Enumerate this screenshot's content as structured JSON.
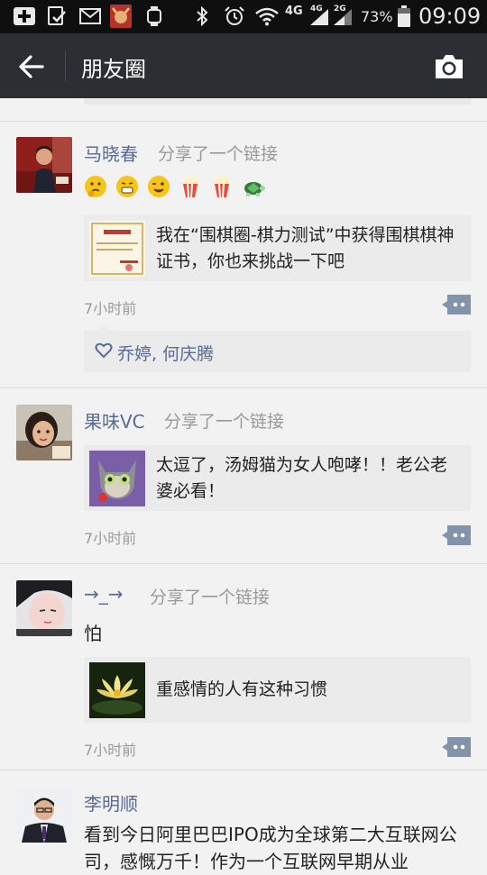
{
  "status_bar": {
    "network_4g": "4G",
    "network_4g_small": "4G",
    "network_2g": "2G",
    "battery": "73%",
    "time": "09:09"
  },
  "nav": {
    "title": "朋友圈",
    "back_icon": "back-arrow-icon",
    "camera_icon": "camera-icon"
  },
  "posts": [
    {
      "name": "马晓春",
      "action": "分享了一个链接",
      "emojis": [
        "thinking-emoji",
        "grin-emoji",
        "wink-emoji",
        "popcorn-emoji",
        "popcorn-emoji",
        "turtle-emoji"
      ],
      "link_text": "我在“围棋圈-棋力测试”中获得围棋棋神证书，你也来挑战一下吧",
      "time": "7小时前",
      "likes": "乔婷, 何庆腾"
    },
    {
      "name": "果味VC",
      "action": "分享了一个链接",
      "link_text": "太逗了，汤姆猫为女人咆哮！！老公老婆必看！",
      "time": "7小时前"
    },
    {
      "name": "→_→",
      "action": "分享了一个链接",
      "text": "怕",
      "link_text": "重感情的人有这种习惯",
      "time": "7小时前"
    },
    {
      "name": "李明顺",
      "text": "看到今日阿里巴巴IPO成为全球第二大互联网公司，感慨万千！作为一个互联网早期从业"
    }
  ],
  "colors": {
    "nav_bg": "#2b2e33",
    "name_link": "#576b95",
    "muted": "#999999",
    "card_bg": "#ebebeb"
  }
}
